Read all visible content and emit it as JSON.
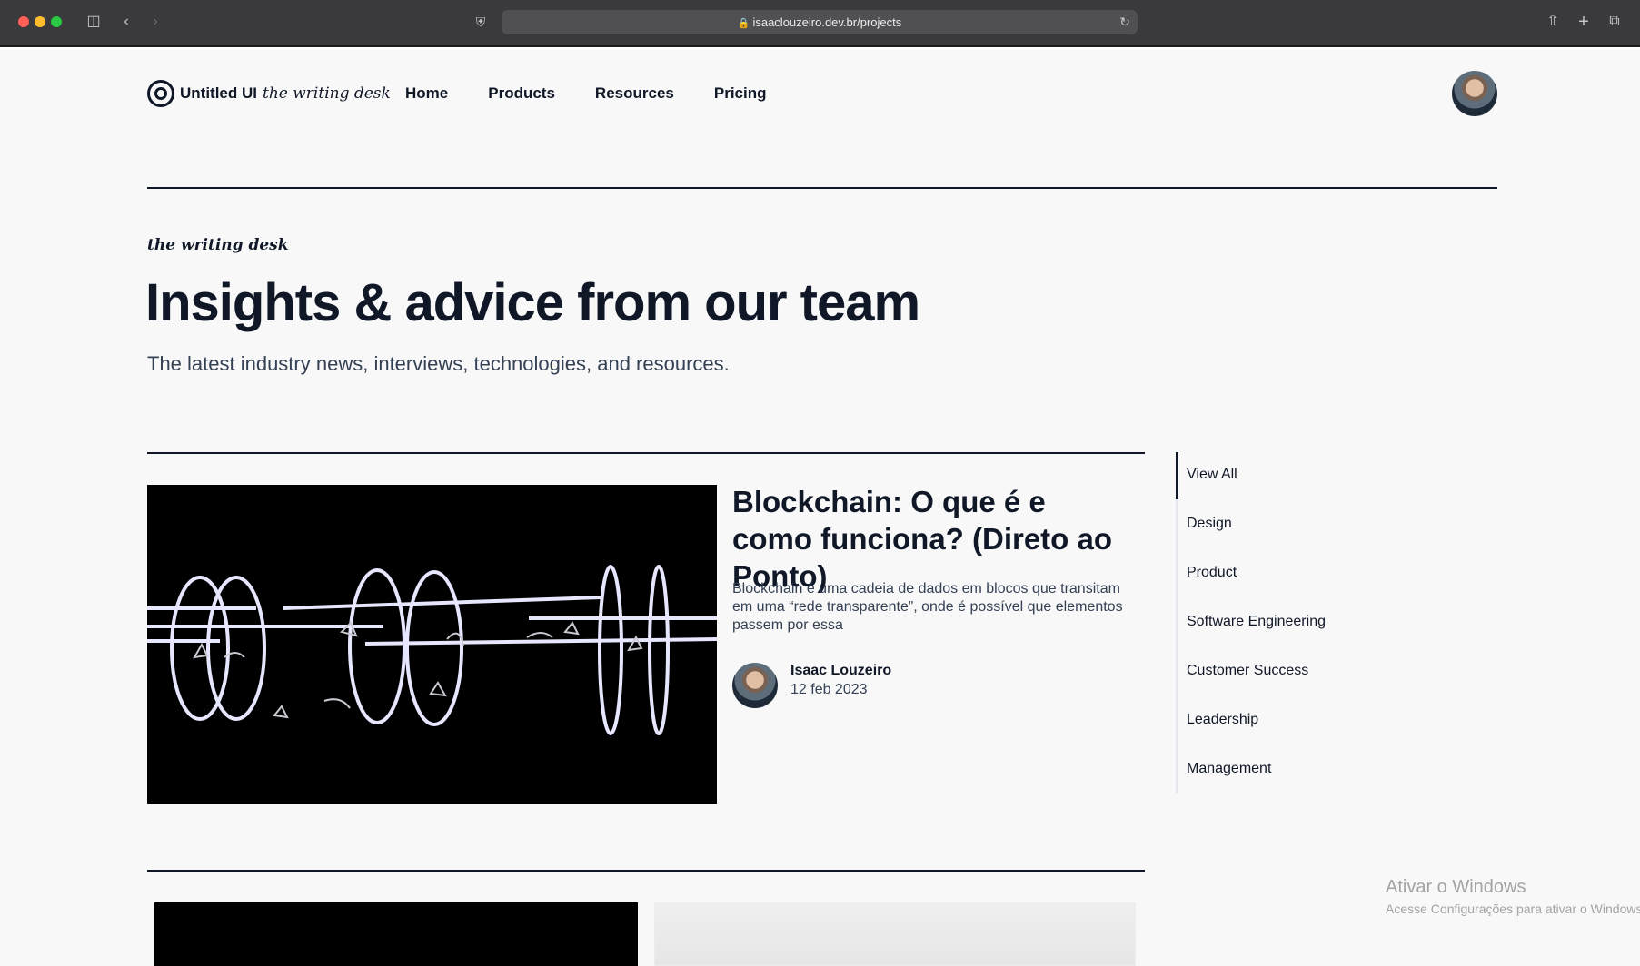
{
  "browser": {
    "url": "isaaclouzeiro.dev.br/projects"
  },
  "nav": {
    "brand": "Untitled UI",
    "brand_script": "the writing desk",
    "links": [
      "Home",
      "Products",
      "Resources",
      "Pricing"
    ]
  },
  "hero": {
    "eyebrow": "the writing desk",
    "title": "Insights & advice from our team",
    "subtitle": "The latest industry news, interviews, technologies, and resources."
  },
  "featured": {
    "title": "Blockchain: O que é e como funciona? (Direto ao Ponto)",
    "excerpt": "Blockchain é uma cadeia de dados em blocos que transitam em uma “rede transparente”, onde é possível que elementos passem por essa",
    "author": "Isaac Louzeiro",
    "date": "12 feb 2023"
  },
  "categories": {
    "items": [
      "View All",
      "Design",
      "Product",
      "Software Engineering",
      "Customer Success",
      "Leadership",
      "Management"
    ],
    "active": "View All"
  },
  "watermark": {
    "title": "Ativar o Windows",
    "subtitle": "Acesse Configurações para ativar o Windows."
  },
  "colors": {
    "text": "#101828",
    "secondary_text": "#344054",
    "page_bg": "#f8f8f8"
  }
}
